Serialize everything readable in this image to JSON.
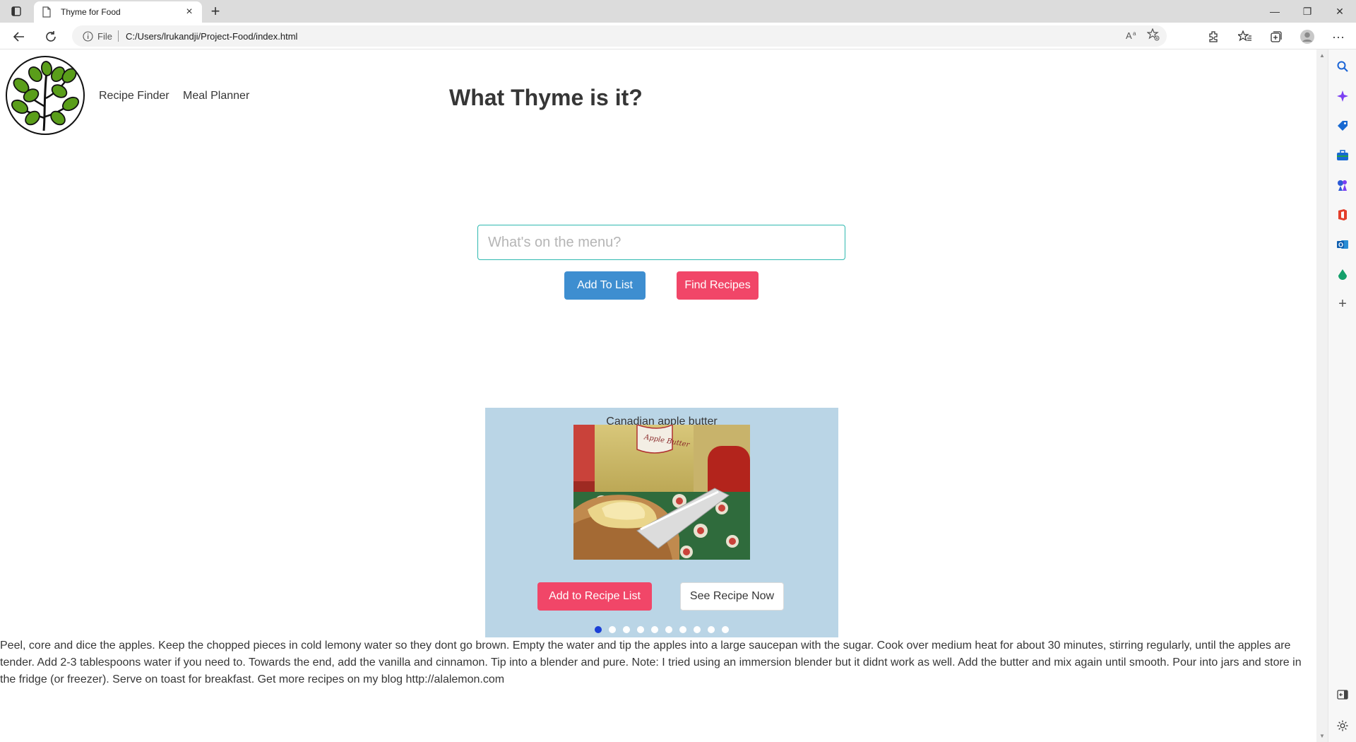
{
  "browser": {
    "tab_title": "Thyme for Food",
    "url_scheme": "File",
    "url": "C:/Users/lrukandji/Project-Food/index.html",
    "read_aloud_label": "Aᵃ"
  },
  "header": {
    "nav": [
      "Recipe Finder",
      "Meal Planner"
    ],
    "title": "What Thyme is it?"
  },
  "search": {
    "placeholder": "What's on the menu?",
    "add_button": "Add To List",
    "find_button": "Find Recipes"
  },
  "carousel": {
    "recipe_title": "Canadian apple butter",
    "image_label": "Apple Butter",
    "add_button": "Add to Recipe List",
    "see_button": "See Recipe Now",
    "slide_count": 10,
    "active_slide": 1
  },
  "recipe": {
    "description": "Peel, core and dice the apples. Keep the chopped pieces in cold lemony water so they dont go brown. Empty the water and tip the apples into a large saucepan with the sugar. Cook over medium heat for about 30 minutes, stirring regularly, until the apples are tender. Add 2-3 tablespoons water if you need to. Towards the end, add the vanilla and cinnamon. Tip into a blender and pure. Note: I tried using an immersion blender but it didnt work as well. Add the butter and mix again until smooth. Pour into jars and store in the fridge (or freezer). Serve on toast for breakfast. Get more recipes on my blog http://alalemon.com"
  },
  "colors": {
    "primary_blue": "#3e8ed0",
    "danger_pink": "#f14668",
    "carousel_bg": "#bad5e6",
    "input_border": "#2fb9b0",
    "active_dot": "#1a3fd6"
  },
  "icons": [
    "tab-actions-icon",
    "page-favicon-icon",
    "close-icon",
    "plus-icon",
    "back-icon",
    "refresh-icon",
    "info-icon",
    "favorite-add-icon",
    "extensions-icon",
    "favorites-icon",
    "collections-icon",
    "profile-icon",
    "more-icon",
    "search-icon",
    "copilot-icon",
    "shopping-icon",
    "tools-icon",
    "games-icon",
    "office-icon",
    "outlook-icon",
    "drop-icon",
    "add-icon",
    "sidebar-toggle-icon",
    "settings-icon"
  ]
}
